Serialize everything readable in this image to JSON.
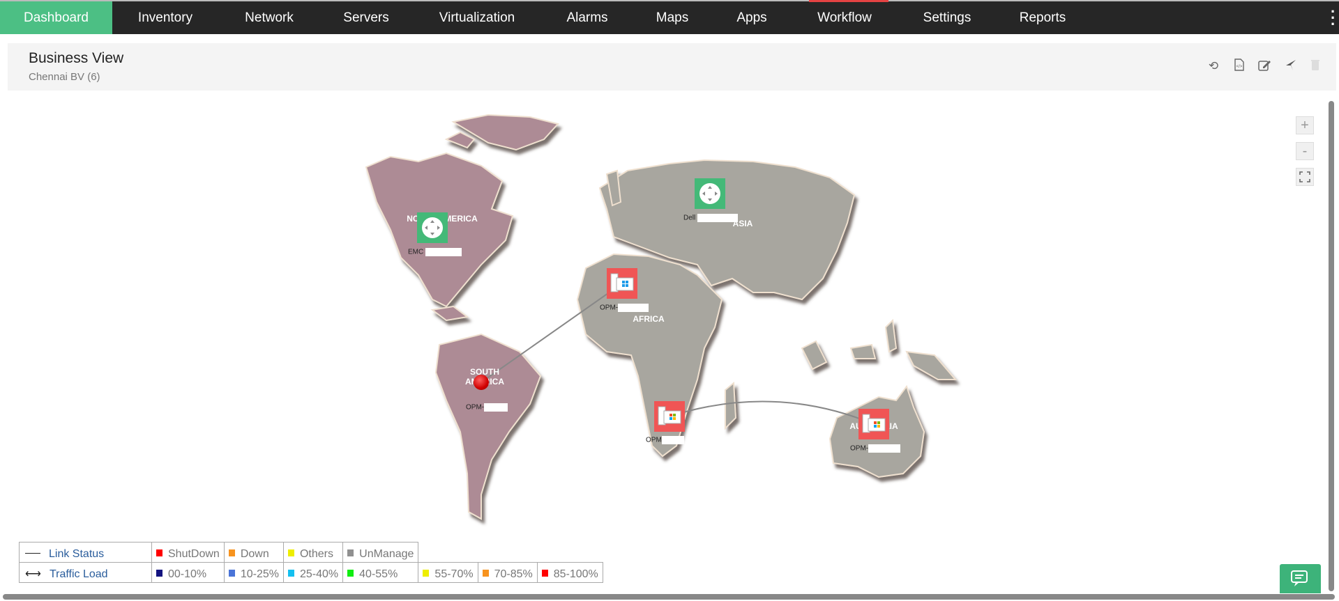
{
  "nav": {
    "items": [
      {
        "label": "Dashboard",
        "active": true
      },
      {
        "label": "Inventory"
      },
      {
        "label": "Network"
      },
      {
        "label": "Servers"
      },
      {
        "label": "Virtualization"
      },
      {
        "label": "Alarms"
      },
      {
        "label": "Maps"
      },
      {
        "label": "Apps"
      },
      {
        "label": "Workflow"
      },
      {
        "label": "Settings"
      },
      {
        "label": "Reports"
      }
    ],
    "active_color": "#4cbf84",
    "more_icon": "vertical-ellipsis-icon"
  },
  "header": {
    "title": "Business View",
    "subtitle": "Chennai BV (6)",
    "icons": [
      "refresh-icon",
      "export-code-icon",
      "edit-icon",
      "pin-icon",
      "delete-icon"
    ]
  },
  "zoom_controls": {
    "zoom_in": "+",
    "zoom_out": "-",
    "fit_icon": "fullscreen-icon"
  },
  "map": {
    "continents": {
      "north_america": "NORTH AMERICA",
      "south_america": "SOUTH AMERICA",
      "asia": "ASIA",
      "africa": "AFRICA",
      "australia": "AUSTRALIA"
    },
    "devices": [
      {
        "label": "EMC",
        "type": "router",
        "status_color": "#44b978"
      },
      {
        "label": "Dell",
        "type": "router",
        "status_color": "#44b978"
      },
      {
        "label": "OPM-",
        "type": "windows-server",
        "status_color": "#f05555"
      },
      {
        "label": "OPM-",
        "type": "status-dot",
        "status_color": "#e00000"
      },
      {
        "label": "OPM",
        "type": "windows-server",
        "status_color": "#f05555"
      },
      {
        "label": "OPM-",
        "type": "windows-server",
        "status_color": "#f05555"
      }
    ]
  },
  "legend": {
    "link_status": {
      "label": "Link Status",
      "items": [
        {
          "label": "ShutDown",
          "color": "#ff0000"
        },
        {
          "label": "Down",
          "color": "#f7931e"
        },
        {
          "label": "Others",
          "color": "#eeee00"
        },
        {
          "label": "UnManage",
          "color": "#909090"
        }
      ]
    },
    "traffic_load": {
      "label": "Traffic Load",
      "items": [
        {
          "label": "00-10%",
          "color": "#141480"
        },
        {
          "label": "10-25%",
          "color": "#4a74d8"
        },
        {
          "label": "25-40%",
          "color": "#14c0f0"
        },
        {
          "label": "40-55%",
          "color": "#10ee10"
        },
        {
          "label": "55-70%",
          "color": "#eeee00"
        },
        {
          "label": "70-85%",
          "color": "#f7931e"
        },
        {
          "label": "85-100%",
          "color": "#ff0000"
        }
      ]
    }
  },
  "chat_icon": "chat-icon"
}
